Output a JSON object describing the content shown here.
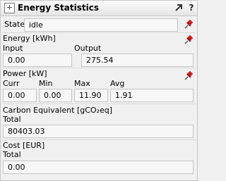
{
  "header": {
    "title": "Energy Statistics",
    "help_label": "?"
  },
  "state": {
    "label": "State",
    "value": "idle"
  },
  "energy": {
    "title": "Energy [kWh]",
    "input_label": "Input",
    "input_value": "0.00",
    "output_label": "Output",
    "output_value": "275.54"
  },
  "power": {
    "title": "Power [kW]",
    "curr_label": "Curr",
    "curr_value": "0.00",
    "min_label": "Min",
    "min_value": "0.00",
    "max_label": "Max",
    "max_value": "11.90",
    "avg_label": "Avg",
    "avg_value": "1.91"
  },
  "carbon": {
    "title": "Carbon Equivalent [gCO₂eq]",
    "total_label": "Total",
    "total_value": "80403.03"
  },
  "cost": {
    "title": "Cost [EUR]",
    "total_label": "Total",
    "total_value": "0.00"
  },
  "colors": {
    "pin": "#d11a1a",
    "field_bg": "#f7f7f7",
    "panel_bg": "#f0f0f0"
  },
  "icons": [
    "panel-toggle-icon",
    "expand-arrow-icon",
    "help-icon",
    "pin-icon"
  ]
}
